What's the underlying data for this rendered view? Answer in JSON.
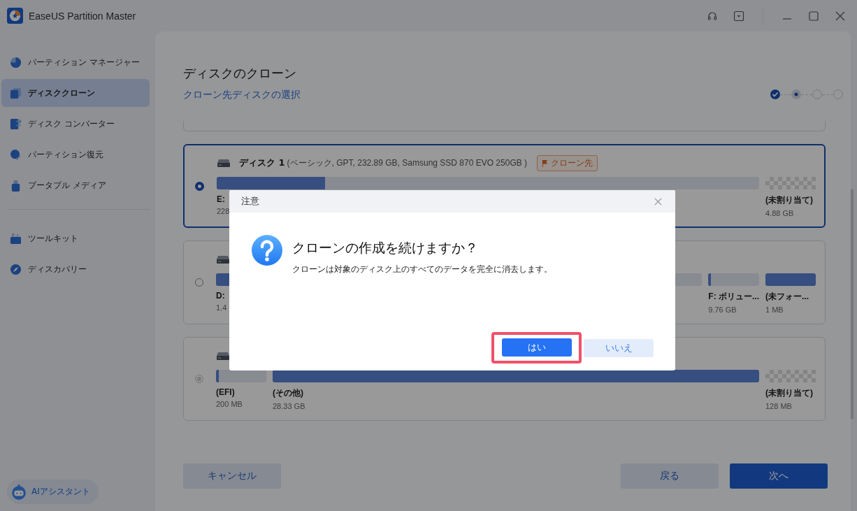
{
  "app": {
    "title": "EaseUS Partition Master"
  },
  "sidebar": {
    "items": [
      {
        "label": "パーティション マネージャー",
        "selected": false
      },
      {
        "label": "ディスククローン",
        "selected": true
      },
      {
        "label": "ディスク コンバーター",
        "selected": false
      },
      {
        "label": "パーティション復元",
        "selected": false
      },
      {
        "label": "ブータブル メディア",
        "selected": false
      }
    ],
    "tools": [
      {
        "label": "ツールキット",
        "selected": false
      },
      {
        "label": "ディスカバリー",
        "selected": false
      }
    ],
    "assistant": {
      "label": "AIアシスタント"
    }
  },
  "page": {
    "title": "ディスクのクローン",
    "subtitle": "クローン先ディスクの選択",
    "steps": [
      {
        "done": true,
        "selected": false
      },
      {
        "done": false,
        "selected": true
      },
      {
        "done": false,
        "selected": false
      },
      {
        "done": false,
        "selected": false
      }
    ]
  },
  "disks": [
    {
      "name": "ディスク 1",
      "info": "(ベーシック, GPT, 232.89 GB, Samsung SSD 870 EVO 250GB )",
      "badge": "クローン先",
      "selected": true,
      "disabled": false,
      "partitions": [
        {
          "kind": "volume",
          "label": "E:",
          "size": "228",
          "level": 0.2
        },
        {
          "kind": "unallocated",
          "label": "(未割り当て)",
          "size": "4.88 GB"
        }
      ]
    },
    {
      "selected": false,
      "disabled": false,
      "partitions": [
        {
          "kind": "volume",
          "label": "D:",
          "size": "1.4",
          "level": 0.03
        },
        {
          "kind": "volume",
          "label": "F: ボリュー...",
          "size": "9.76 GB",
          "level": 0.05
        },
        {
          "kind": "volume",
          "label": "(未フォー...",
          "size": "1 MB",
          "level": 1
        }
      ]
    },
    {
      "selected": false,
      "disabled": true,
      "partitions": [
        {
          "kind": "volume",
          "label": "(EFI)",
          "size": "200 MB",
          "level": 0.05
        },
        {
          "kind": "volume",
          "label": "(その他)",
          "size": "28.33 GB",
          "level": 1
        },
        {
          "kind": "unallocated",
          "label": "(未割り当て)",
          "size": "128 MB"
        }
      ]
    }
  ],
  "footer": {
    "buttons": [
      {
        "label": "キャンセル",
        "kind": "secondary"
      },
      {
        "label": "戻る",
        "kind": "secondary"
      },
      {
        "label": "次へ",
        "kind": "primary"
      }
    ]
  },
  "dialog": {
    "title": "注意",
    "heading": "クローンの作成を続けますか？",
    "message": "クローンは対象のディスク上のすべてのデータを完全に消去します。",
    "buttons": [
      {
        "label": "はい",
        "kind": "primary",
        "focused": true
      },
      {
        "label": "いいえ",
        "kind": "secondary",
        "focused": false
      }
    ]
  }
}
